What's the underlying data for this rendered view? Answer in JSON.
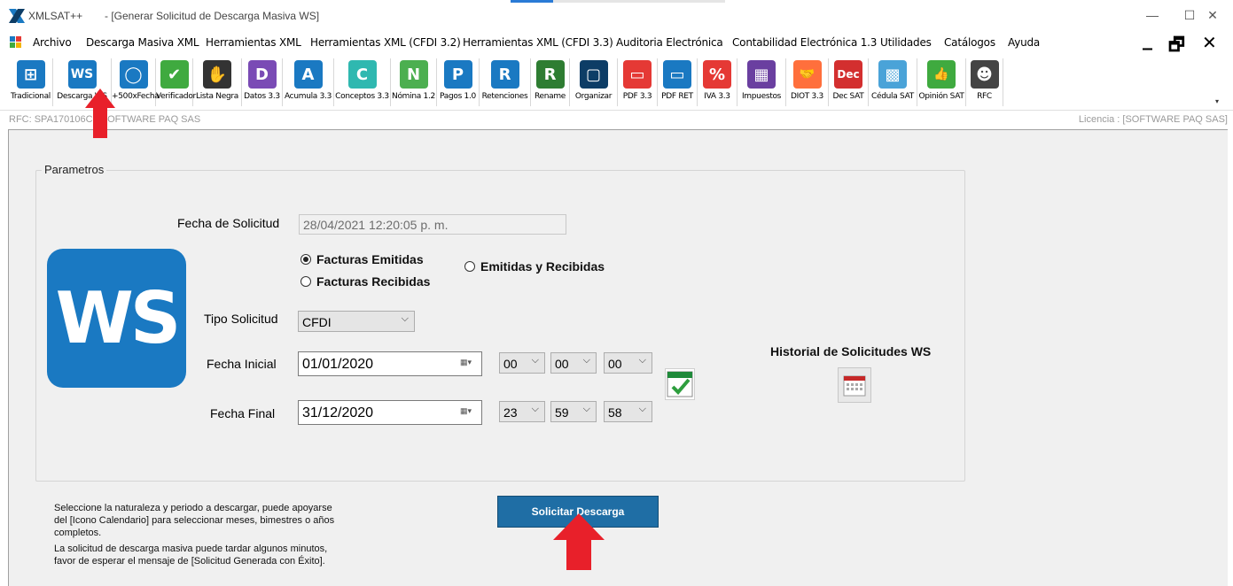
{
  "window": {
    "app_name": "XMLSAT++",
    "doc_title": "- [Generar Solicitud de Descarga Masiva WS]",
    "minimize": "—",
    "maximize": "☐",
    "close": "✕"
  },
  "menu": {
    "items": [
      "Archivo",
      "Descarga Masiva XML",
      "Herramientas XML",
      "Herramientas XML (CFDI 3.2)",
      "Herramientas XML (CFDI 3.3)",
      "Auditoria Electrónica",
      "Contabilidad Electrónica 1.3",
      "Utilidades",
      "Catálogos",
      "Ayuda"
    ],
    "mdi_min": "_",
    "mdi_restore": "🗗",
    "mdi_close": "✕"
  },
  "toolbar": {
    "buttons": [
      {
        "label": "Tradicional",
        "icon": "grid-icon",
        "glyph": "⊞",
        "color": "#1a79c2"
      },
      {
        "label": "Descarga WS",
        "icon": "ws-icon",
        "glyph": "WS",
        "color": "#1a79c2"
      },
      {
        "label": "+500xFecha",
        "icon": "capsule-icon",
        "glyph": "◯",
        "color": "#1a79c2"
      },
      {
        "label": "Verificador",
        "icon": "check-icon",
        "glyph": "✔",
        "color": "#3faa3f"
      },
      {
        "label": "Lista Negra",
        "icon": "hand-icon",
        "glyph": "✋",
        "color": "#333333"
      },
      {
        "label": "Datos 3.3",
        "icon": "d-icon",
        "glyph": "D",
        "color": "#7a4bb5"
      },
      {
        "label": "Acumula 3.3",
        "icon": "a-icon",
        "glyph": "A",
        "color": "#1a79c2"
      },
      {
        "label": "Conceptos 3.3",
        "icon": "c-icon",
        "glyph": "C",
        "color": "#2fb8b0"
      },
      {
        "label": "Nómina 1.2",
        "icon": "n-icon",
        "glyph": "N",
        "color": "#4caf50"
      },
      {
        "label": "Pagos 1.0",
        "icon": "p-icon",
        "glyph": "P",
        "color": "#1a79c2"
      },
      {
        "label": "Retenciones",
        "icon": "r-icon",
        "glyph": "R",
        "color": "#1a79c2"
      },
      {
        "label": "Rename",
        "icon": "rename-icon",
        "glyph": "R",
        "color": "#2e7d32"
      },
      {
        "label": "Organizar",
        "icon": "folder-icon",
        "glyph": "▢",
        "color": "#0d3d66"
      },
      {
        "label": "PDF 3.3",
        "icon": "pdf-icon",
        "glyph": "▭",
        "color": "#e53935"
      },
      {
        "label": "PDF RET",
        "icon": "pdf-ret-icon",
        "glyph": "▭",
        "color": "#1a79c2"
      },
      {
        "label": "IVA 3.3",
        "icon": "percent-icon",
        "glyph": "%",
        "color": "#e53935"
      },
      {
        "label": "Impuestos",
        "icon": "calculator-icon",
        "glyph": "▦",
        "color": "#6a3fa0"
      },
      {
        "label": "DIOT 3.3",
        "icon": "handshake-icon",
        "glyph": "🤝",
        "color": "#ff6f3c"
      },
      {
        "label": "Dec SAT",
        "icon": "dec-icon",
        "glyph": "Dec",
        "color": "#d32f2f"
      },
      {
        "label": "Cédula SAT",
        "icon": "qr-icon",
        "glyph": "▩",
        "color": "#4aa3d8"
      },
      {
        "label": "Opinión SAT",
        "icon": "thumbs-up-icon",
        "glyph": "👍",
        "color": "#3faa3f"
      },
      {
        "label": "RFC",
        "icon": "person-icon",
        "glyph": "☻",
        "color": "#444444"
      }
    ]
  },
  "status": {
    "rfc": "RFC: SPA170106C9 SOFTWARE PAQ SAS",
    "license": "Licencia : [SOFTWARE PAQ SAS]"
  },
  "form": {
    "group_title": "Parametros",
    "fecha_solicitud_label": "Fecha de Solicitud",
    "fecha_solicitud_value": "28/04/2021 12:20:05 p. m.",
    "logo_text": "WS",
    "radio_emitidas": "Facturas Emitidas",
    "radio_recibidas": "Facturas Recibidas",
    "radio_ambas": "Emitidas y Recibidas",
    "radio_selected": "Facturas Emitidas",
    "tipo_label": "Tipo Solicitud",
    "tipo_value": "CFDI",
    "fecha_inicial_label": "Fecha Inicial",
    "fecha_inicial_value": "01/01/2020",
    "inicial_hh": "00",
    "inicial_mm": "00",
    "inicial_ss": "00",
    "fecha_final_label": "Fecha Final",
    "fecha_final_value": "31/12/2020",
    "final_hh": "23",
    "final_mm": "59",
    "final_ss": "58",
    "historial_label": "Historial de Solicitudes WS"
  },
  "help": {
    "line1": "Seleccione la naturaleza y periodo a descargar, puede apoyarse",
    "line2": "del [Icono Calendario] para seleccionar meses, bimestres o años",
    "line3": "completos.",
    "line4": "La solicitud de descarga masiva puede tardar algunos minutos,",
    "line5": "favor de esperar el mensaje de [Solicitud Generada con Éxito]."
  },
  "actions": {
    "solicitar": "Solicitar  Descarga"
  },
  "colors": {
    "accent": "#1a79c2",
    "button": "#1f6ea5",
    "arrow": "#e8202a",
    "panel": "#f0f0f0"
  }
}
